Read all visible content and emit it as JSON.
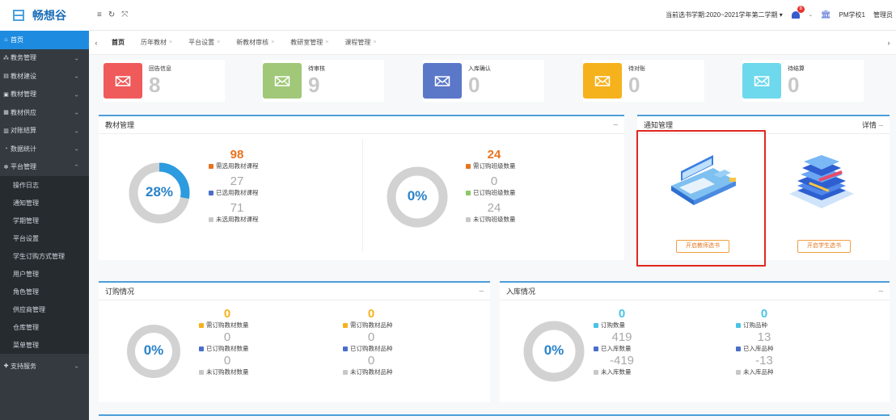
{
  "app": {
    "name": "畅想谷"
  },
  "sidebar": {
    "items": [
      {
        "label": "首页",
        "icon": "home-icon",
        "active": true
      },
      {
        "label": "教务管理",
        "icon": "org-icon"
      },
      {
        "label": "教材建设",
        "icon": "doc-icon"
      },
      {
        "label": "教材管理",
        "icon": "book-icon"
      },
      {
        "label": "教材供应",
        "icon": "box-icon"
      },
      {
        "label": "对账结算",
        "icon": "calc-icon"
      },
      {
        "label": "数据统计",
        "icon": "chart-icon"
      },
      {
        "label": "平台管理",
        "icon": "gear-icon"
      }
    ],
    "subitems": [
      "操作日志",
      "通知管理",
      "学期管理",
      "平台设置",
      "学生订购方式管理",
      "用户管理",
      "角色管理",
      "供应商管理",
      "仓库管理",
      "菜单管理"
    ],
    "bottom": {
      "label": "支持服务",
      "icon": "support-icon"
    }
  },
  "topbar": {
    "semester": "当前选书学期:2020~2021学年第二学期",
    "badge": "8",
    "school": "PM学校1",
    "user": "管理员"
  },
  "tabs": [
    "首页",
    "历年教材",
    "平台设置",
    "新教材审核",
    "教研室管理",
    "课程管理"
  ],
  "stats": [
    {
      "label": "回告信息",
      "value": "8",
      "color": "#ef5a5a"
    },
    {
      "label": "待审核",
      "value": "9",
      "color": "#a0c878"
    },
    {
      "label": "入库确认",
      "value": "0",
      "color": "#5b77c8"
    },
    {
      "label": "待对账",
      "value": "0",
      "color": "#f6b21c"
    },
    {
      "label": "待结算",
      "value": "0",
      "color": "#6ed8ec"
    }
  ],
  "textbook_panel": {
    "title": "教材管理",
    "left": {
      "percent": "28%",
      "fraction": 0.28,
      "rows": [
        {
          "value": "98",
          "label": "需选用教材课程",
          "color": "#e8731e"
        },
        {
          "value": "27",
          "label": "已选用教材课程",
          "color": "#4a6fc9"
        },
        {
          "value": "71",
          "label": "未选用教材课程",
          "color": "#c8c8c8"
        }
      ]
    },
    "right": {
      "percent": "0%",
      "fraction": 0,
      "rows": [
        {
          "value": "24",
          "label": "需订购班级数量",
          "color": "#e8731e"
        },
        {
          "value": "0",
          "label": "已订购班级数量",
          "color": "#8cc866"
        },
        {
          "value": "24",
          "label": "未订购班级数量",
          "color": "#c8c8c8"
        }
      ]
    }
  },
  "notice_panel": {
    "title": "通知管理",
    "detail": "详情",
    "teacher_button": "开启教师选书",
    "student_button": "开启学生选书"
  },
  "order_panel": {
    "title": "订购情况",
    "percent": "0%",
    "fraction": 0,
    "col1": [
      {
        "value": "0",
        "label": "需订购教材数量",
        "color": "#f6b21c"
      },
      {
        "value": "0",
        "label": "已订购教材数量",
        "color": "#4a6fc9"
      },
      {
        "value": "0",
        "label": "未订购教材数量",
        "color": "#c8c8c8"
      }
    ],
    "col2": [
      {
        "value": "0",
        "label": "需订购教材品种",
        "color": "#f6b21c"
      },
      {
        "value": "0",
        "label": "已订购教材品种",
        "color": "#4a6fc9"
      },
      {
        "value": "0",
        "label": "未订购教材品种",
        "color": "#c8c8c8"
      }
    ]
  },
  "stock_panel": {
    "title": "入库情况",
    "percent": "0%",
    "fraction": 0,
    "col1": [
      {
        "value": "0",
        "label": "订购数量",
        "color": "#4bc3e8"
      },
      {
        "value": "419",
        "label": "已入库数量",
        "color": "#4a6fc9"
      },
      {
        "value": "-419",
        "label": "未入库数量",
        "color": "#c8c8c8"
      }
    ],
    "col2": [
      {
        "value": "0",
        "label": "订购品种",
        "color": "#4bc3e8"
      },
      {
        "value": "13",
        "label": "已入库品种",
        "color": "#4a6fc9"
      },
      {
        "value": "-13",
        "label": "未入库品种",
        "color": "#c8c8c8"
      }
    ]
  }
}
